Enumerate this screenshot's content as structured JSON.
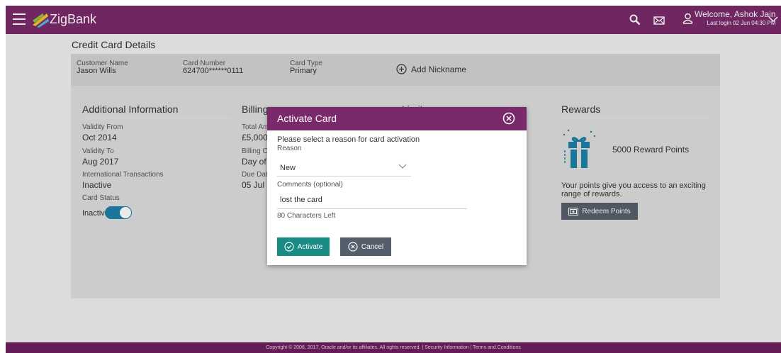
{
  "header": {
    "brand": "ZigBank",
    "welcome": "Welcome, Ashok Jain",
    "last_login": "Last login 02 Jun 04:30 PM",
    "icons": [
      "menu-icon",
      "search-icon",
      "mail-icon",
      "user-icon",
      "chevron-down-icon"
    ],
    "color": "#7a2a6a"
  },
  "page": {
    "title": "Credit Card Details"
  },
  "customer": {
    "name_label": "Customer Name",
    "name": "Jason Wills",
    "card_number_label": "Card Number",
    "card_number": "624700******0111",
    "card_type_label": "Card Type",
    "card_type": "Primary",
    "add_nickname": "Add Nickname"
  },
  "additional": {
    "heading": "Additional Information",
    "validity_from_label": "Validity From",
    "validity_from": "Oct 2014",
    "validity_to_label": "Validity To",
    "validity_to": "Aug 2017",
    "intl_label": "International Transactions",
    "intl_value": "Inactive",
    "card_status_label": "Card Status",
    "card_status": "Inactive"
  },
  "billing": {
    "heading": "Billing",
    "total_amount_label": "Total Am",
    "total_amount": "£5,000.",
    "billing_cycle_label": "Billing Cy",
    "billing_cycle": "Day of e",
    "due_date_label": "Due Date",
    "due_date": "05 Jul"
  },
  "limits": {
    "heading": "Limits"
  },
  "rewards": {
    "heading": "Rewards",
    "points": "5000 Reward Points",
    "description": "Your points give you access to an exciting range of rewards.",
    "redeem_button": "Redeem Points"
  },
  "modal": {
    "title": "Activate Card",
    "prompt": "Please select a reason for card activation",
    "reason_label": "Reason",
    "reason_value": "New",
    "comments_label": "Comments (optional)",
    "comments_value": "lost the card",
    "chars_left": "80 Characters Left",
    "activate_button": "Activate",
    "cancel_button": "Cancel",
    "accent": "#1a8a85"
  },
  "footer": {
    "text": "Copyright © 2006, 2017, Oracle and/or its affiliates. All rights reserved. | Security Information | Terms and Conditions"
  }
}
